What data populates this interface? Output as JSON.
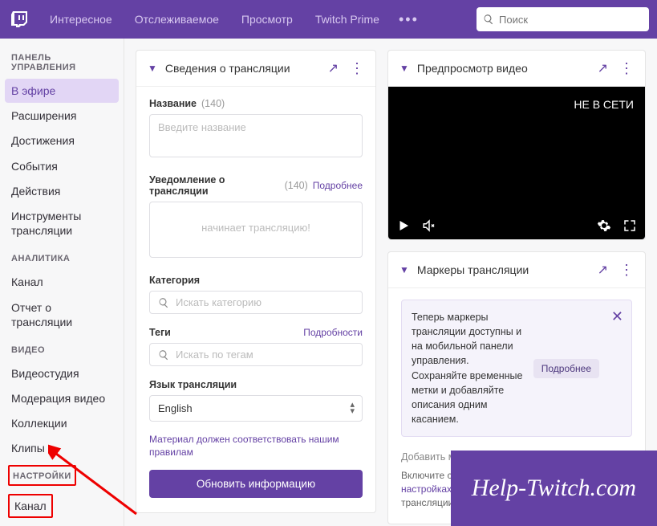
{
  "topnav": {
    "items": [
      "Интересное",
      "Отслеживаемое",
      "Просмотр",
      "Twitch Prime"
    ],
    "search_placeholder": "Поиск"
  },
  "sidebar": {
    "sections": [
      {
        "head": "ПАНЕЛЬ УПРАВЛЕНИЯ",
        "links": [
          "В эфире",
          "Расширения",
          "Достижения",
          "События",
          "Действия",
          "Инструменты трансляции"
        ],
        "active_index": 0
      },
      {
        "head": "АНАЛИТИКА",
        "links": [
          "Канал",
          "Отчет о трансляции"
        ]
      },
      {
        "head": "ВИДЕО",
        "links": [
          "Видеостудия",
          "Модерация видео",
          "Коллекции",
          "Клипы"
        ]
      },
      {
        "head": "НАСТРОЙКИ",
        "links": [
          "Канал"
        ]
      }
    ]
  },
  "stream_info": {
    "card_title": "Сведения о трансляции",
    "title_label": "Название",
    "title_max": "(140)",
    "title_placeholder": "Введите название",
    "notify_label": "Уведомление о трансляции",
    "notify_max": "(140)",
    "notify_link": "Подробнее",
    "notify_placeholder": "начинает трансляцию!",
    "category_label": "Категория",
    "category_placeholder": "Искать категорию",
    "tags_label": "Теги",
    "tags_link": "Подробности",
    "tags_placeholder": "Искать по тегам",
    "lang_label": "Язык трансляции",
    "lang_value": "English",
    "footnote": "Материал должен соответствовать нашим правилам",
    "submit": "Обновить информацию"
  },
  "preview": {
    "card_title": "Предпросмотр видео",
    "offline": "НЕ В СЕТИ"
  },
  "markers": {
    "card_title": "Маркеры трансляции",
    "banner_text": "Теперь маркеры трансляции доступны и на мобильной панели управления. Сохраняйте временные метки и добавляйте описания одним касанием.",
    "banner_more": "Подробнее",
    "add_label": "Добавить маркер трансляции",
    "helper_pre": "Включите сохранение прошедших трансляций в ",
    "helper_link": "настройках канала",
    "helper_post": ", чтобы добавлять маркеры трансляции"
  },
  "watermark": "Help-Twitch.com"
}
